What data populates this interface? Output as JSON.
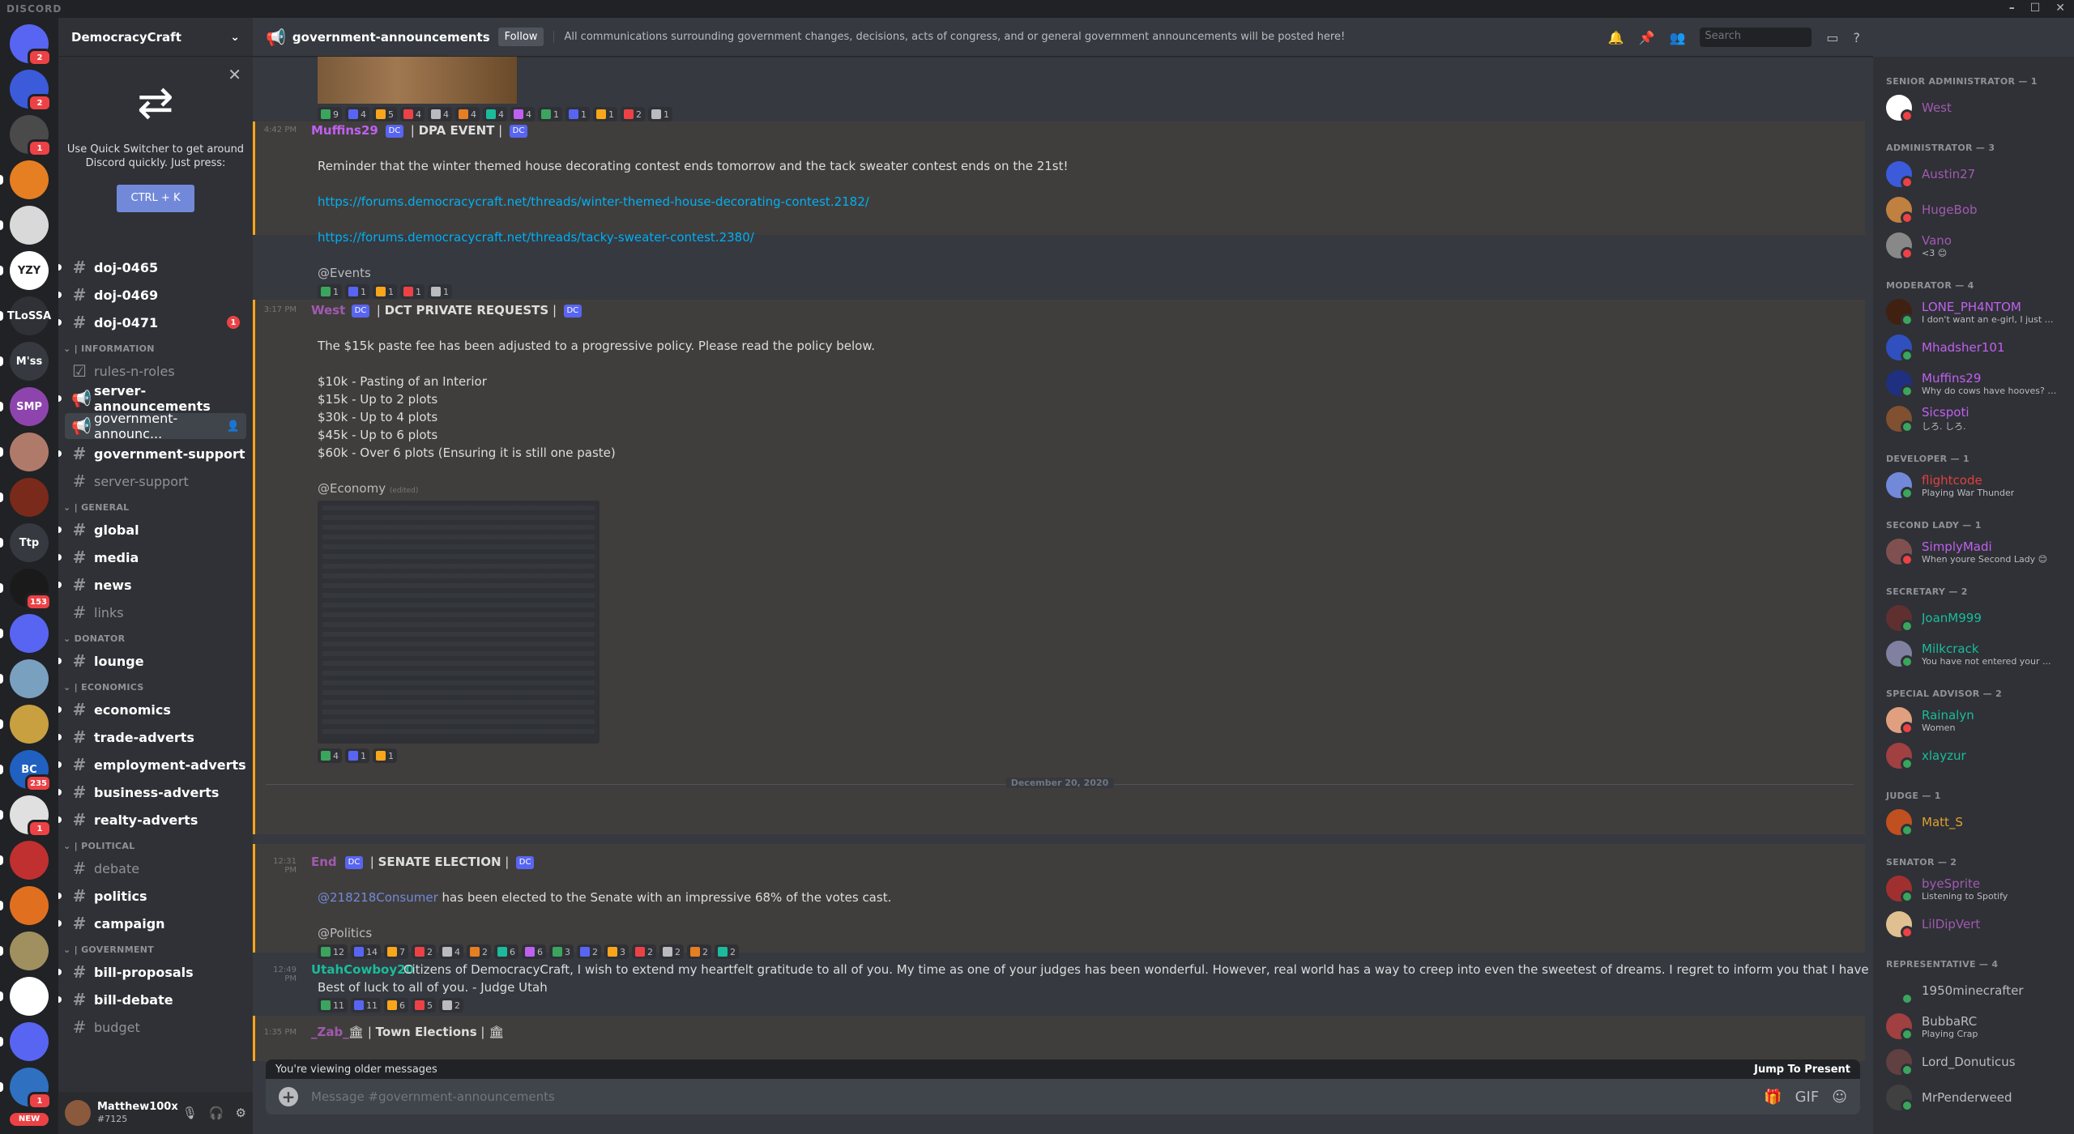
{
  "app": {
    "title": "DISCORD"
  },
  "server": {
    "name": "DemocracyCraft"
  },
  "quick_switcher": {
    "text": "Use Quick Switcher to get around Discord quickly. Just press:",
    "button": "CTRL + K"
  },
  "guilds": [
    {
      "label": "",
      "color": "#5865f2",
      "badge": "2"
    },
    {
      "label": "",
      "color": "#3b5bdb",
      "badge": "2"
    },
    {
      "label": "",
      "color": "#4a4a4a",
      "badge": "1"
    },
    {
      "label": "",
      "color": "#e67e22",
      "badge": ""
    },
    {
      "label": "",
      "color": "#d9d9d9",
      "badge": ""
    },
    {
      "label": "YZY",
      "color": "#ffffff",
      "badge": ""
    },
    {
      "label": "TLoSSA",
      "color": "#2f3136",
      "badge": ""
    },
    {
      "label": "M'ss",
      "color": "#36393f",
      "badge": ""
    },
    {
      "label": "SMP",
      "color": "#8e44ad",
      "badge": ""
    },
    {
      "label": "",
      "color": "#b07a6a",
      "badge": ""
    },
    {
      "label": "",
      "color": "#7a2a1a",
      "badge": ""
    },
    {
      "label": "Ttp",
      "color": "#36393f",
      "badge": ""
    },
    {
      "label": "",
      "color": "#1a1a1a",
      "badge": "153"
    },
    {
      "label": "",
      "color": "#5865f2",
      "badge": ""
    },
    {
      "label": "",
      "color": "#7aa0c0",
      "badge": ""
    },
    {
      "label": "",
      "color": "#c8a040",
      "badge": ""
    },
    {
      "label": "BC",
      "color": "#2060c0",
      "badge": "235"
    },
    {
      "label": "",
      "color": "#e0e0e0",
      "badge": "1"
    },
    {
      "label": "",
      "color": "#c03030",
      "badge": ""
    },
    {
      "label": "",
      "color": "#e07020",
      "badge": ""
    },
    {
      "label": "",
      "color": "#a09060",
      "badge": ""
    },
    {
      "label": "",
      "color": "#ffffff",
      "badge": ""
    },
    {
      "label": "",
      "color": "#5865f2",
      "badge": ""
    },
    {
      "label": "",
      "color": "#3070c0",
      "badge": "1"
    }
  ],
  "new_badge": "NEW",
  "channels": {
    "top": [
      {
        "name": "doj-0465",
        "unread": true,
        "mention": ""
      },
      {
        "name": "doj-0469",
        "unread": true,
        "mention": ""
      },
      {
        "name": "doj-0471",
        "unread": true,
        "mention": "1"
      }
    ],
    "information": {
      "label": "| INFORMATION",
      "items": [
        {
          "name": "rules-n-roles",
          "unread": false,
          "icon": "☑"
        },
        {
          "name": "server-announcements",
          "unread": true,
          "icon": "📢"
        },
        {
          "name": "government-announc...",
          "unread": false,
          "icon": "📢",
          "selected": true
        },
        {
          "name": "government-support",
          "unread": true,
          "icon": "#"
        },
        {
          "name": "server-support",
          "unread": false,
          "icon": "#"
        }
      ]
    },
    "general": {
      "label": "| GENERAL",
      "items": [
        {
          "name": "global",
          "unread": true
        },
        {
          "name": "media",
          "unread": true
        },
        {
          "name": "news",
          "unread": true
        },
        {
          "name": "links",
          "unread": false
        }
      ]
    },
    "donator": {
      "label": "DONATOR",
      "items": [
        {
          "name": "lounge",
          "unread": true
        }
      ]
    },
    "economics": {
      "label": "| ECONOMICS",
      "items": [
        {
          "name": "economics",
          "unread": true
        },
        {
          "name": "trade-adverts",
          "unread": true
        },
        {
          "name": "employment-adverts",
          "unread": true
        },
        {
          "name": "business-adverts",
          "unread": true
        },
        {
          "name": "realty-adverts",
          "unread": true
        }
      ]
    },
    "political": {
      "label": "| POLITICAL",
      "items": [
        {
          "name": "debate",
          "unread": false
        },
        {
          "name": "politics",
          "unread": true
        },
        {
          "name": "campaign",
          "unread": true
        }
      ]
    },
    "government": {
      "label": "| GOVERNMENT",
      "items": [
        {
          "name": "bill-proposals",
          "unread": true
        },
        {
          "name": "bill-debate",
          "unread": true
        },
        {
          "name": "budget",
          "unread": false
        }
      ]
    }
  },
  "user": {
    "name": "Matthew100x",
    "tag": "#7125"
  },
  "chat": {
    "channel": "government-announcements",
    "follow": "Follow",
    "topic": "All communications surrounding government changes, decisions, acts of congress, and or general government announcements will be posted here!",
    "search_placeholder": "Search",
    "messages": [
      {
        "time": "4:42 PM",
        "author": "Muffins29",
        "title": "DPA EVENT",
        "lines": [
          "Reminder that the winter themed house decorating contest ends tomorrow and the tack sweater contest ends on the 21st!"
        ],
        "links": [
          "https://forums.democracycraft.net/threads/winter-themed-house-decorating-contest.2182/",
          "https://forums.democracycraft.net/threads/tacky-sweater-contest.2380/"
        ],
        "role": "@Events"
      },
      {
        "time": "3:17 PM",
        "author": "West",
        "title": "DCT PRIVATE REQUESTS",
        "lines": [
          "The $15k paste fee has been adjusted to a progressive policy. Please read the policy below.",
          "$10k - Pasting of an Interior",
          "$15k -  Up to 2 plots",
          "$30k - Up to 4 plots",
          "$45k - Up to 6 plots",
          "$60k - Over 6 plots (Ensuring it is still one paste)"
        ],
        "role": "@Economy",
        "edited": "(edited)"
      },
      {
        "time": "12:31 PM",
        "author": "End",
        "title": "SENATE ELECTION",
        "mention": "@218218Consumer",
        "text": "has been elected to the Senate with an impressive 68% of the votes cast.",
        "role": "@Politics"
      },
      {
        "time": "12:49 PM",
        "author": "UtahCowboy20",
        "text": "Citizens of DemocracyCraft, I wish to extend my heartfelt gratitude to all of you. My time as one of your judges has been wonderful. However, real world has a way to creep into even the sweetest of dreams. I regret to inform you that I have handed in my resignation.",
        "text2": "Best of luck to all of you. - Judge Utah"
      },
      {
        "time": "1:35 PM",
        "author": "_Zab_",
        "title": "Town Elections"
      }
    ],
    "date_divider": "December 20, 2020",
    "reactions_top": [
      "9",
      "4",
      "5",
      "4",
      "4",
      "4",
      "4",
      "4",
      "1",
      "1",
      "1",
      "2",
      "1"
    ],
    "reactions_m1": [
      "1",
      "1",
      "1",
      "1",
      "1"
    ],
    "reactions_m2": [
      "4",
      "1",
      "1"
    ],
    "reactions_m3": [
      "12",
      "14",
      "7",
      "2",
      "4",
      "2",
      "6",
      "6",
      "3",
      "2",
      "3",
      "2",
      "2",
      "2",
      "2"
    ],
    "reactions_m4": [
      "11",
      "11",
      "6",
      "5",
      "2"
    ],
    "older_notice": "You're viewing older messages",
    "jump": "Jump To Present",
    "composer_placeholder": "Message #government-announcements"
  },
  "members": [
    {
      "role": "SENIOR ADMINISTRATOR — 1",
      "users": [
        {
          "name": "West",
          "color": "#a05ab0",
          "status": "",
          "st": "#ed4245",
          "av": "#ffffff"
        }
      ]
    },
    {
      "role": "ADMINISTRATOR — 3",
      "users": [
        {
          "name": "Austin27",
          "color": "#a05ab0",
          "status": "",
          "st": "#ed4245",
          "av": "#3b5bdb"
        },
        {
          "name": "HugeBob",
          "color": "#a05ab0",
          "status": "",
          "st": "#ed4245",
          "av": "#c08040"
        },
        {
          "name": "Vano",
          "color": "#a05ab0",
          "status": "<3 😊",
          "st": "#ed4245",
          "av": "#888888"
        }
      ]
    },
    {
      "role": "MODERATOR — 4",
      "users": [
        {
          "name": "LONE_PH4NTOM",
          "color": "#c060f0",
          "status": "I don't want an e-girl, I just wa...",
          "st": "#3ba55d",
          "av": "#402010"
        },
        {
          "name": "Mhadsher101",
          "color": "#c060f0",
          "status": "",
          "st": "#3ba55d",
          "av": "#3050c0"
        },
        {
          "name": "Muffins29",
          "color": "#c060f0",
          "status": "Why do cows have hooves? Bc...",
          "st": "#3ba55d",
          "av": "#203080"
        },
        {
          "name": "Sicspoti",
          "color": "#c060f0",
          "status": "しろ. しろ.",
          "st": "#3ba55d",
          "av": "#805030"
        }
      ]
    },
    {
      "role": "DEVELOPER — 1",
      "users": [
        {
          "name": "flightcode",
          "color": "#e04040",
          "status": "Playing War Thunder",
          "st": "#3ba55d",
          "av": "#7289da"
        }
      ]
    },
    {
      "role": "SECOND LADY — 1",
      "users": [
        {
          "name": "SimplyMadi",
          "color": "#c060f0",
          "status": "When youre Second Lady 😊",
          "st": "#ed4245",
          "av": "#805050"
        }
      ]
    },
    {
      "role": "SECRETARY — 2",
      "users": [
        {
          "name": "JoanM999",
          "color": "#1abc9c",
          "status": "",
          "st": "#3ba55d",
          "av": "#603030"
        },
        {
          "name": "Milkcrack",
          "color": "#1abc9c",
          "status": "You have not entered your ...",
          "st": "#3ba55d",
          "av": "#8080a0"
        }
      ]
    },
    {
      "role": "SPECIAL ADVISOR — 2",
      "users": [
        {
          "name": "Rainalyn",
          "color": "#1abc9c",
          "status": "Women",
          "st": "#ed4245",
          "av": "#e0a080"
        },
        {
          "name": "xlayzur",
          "color": "#1abc9c",
          "status": "",
          "st": "#3ba55d",
          "av": "#a04040"
        }
      ]
    },
    {
      "role": "JUDGE — 1",
      "users": [
        {
          "name": "Matt_S",
          "color": "#e0a030",
          "status": "",
          "st": "#3ba55d",
          "av": "#c05020"
        }
      ]
    },
    {
      "role": "SENATOR — 2",
      "users": [
        {
          "name": "byeSprite",
          "color": "#a05ab0",
          "status": "Listening to Spotify",
          "st": "#3ba55d",
          "av": "#a03030"
        },
        {
          "name": "LilDipVert",
          "color": "#a05ab0",
          "status": "",
          "st": "#ed4245",
          "av": "#e0c090"
        }
      ]
    },
    {
      "role": "REPRESENTATIVE — 4",
      "users": [
        {
          "name": "1950minecrafter",
          "color": "#b9bbbe",
          "status": "",
          "st": "#3ba55d",
          "av": "#2f3136"
        },
        {
          "name": "BubbaRC",
          "color": "#b9bbbe",
          "status": "Playing Crap",
          "st": "#3ba55d",
          "av": "#a04040"
        },
        {
          "name": "Lord_Donuticus",
          "color": "#b9bbbe",
          "status": "",
          "st": "#3ba55d",
          "av": "#604040"
        },
        {
          "name": "MrPenderweed",
          "color": "#b9bbbe",
          "status": "",
          "st": "#3ba55d",
          "av": "#404040"
        }
      ]
    }
  ]
}
